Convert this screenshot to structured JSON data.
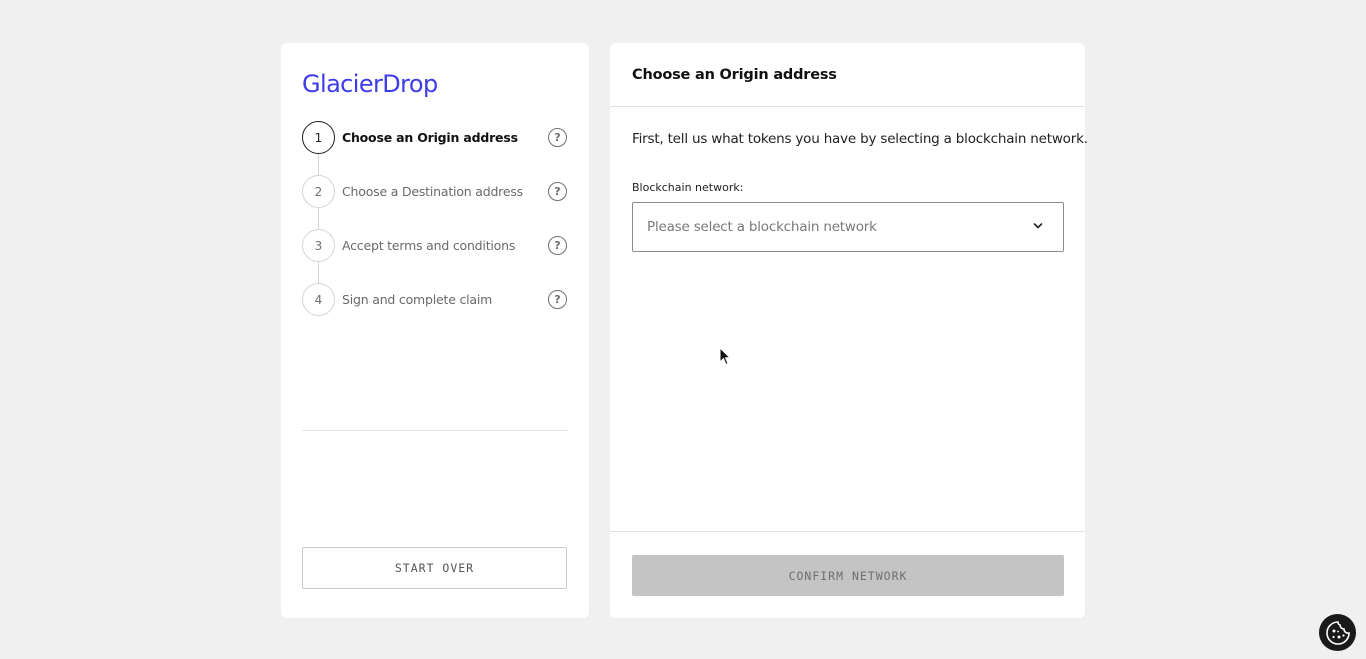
{
  "brand": {
    "logo_text": "GlacierDrop",
    "accent_color": "#3d3ce8"
  },
  "steps": [
    {
      "number": "1",
      "label": "Choose an Origin address",
      "active": true
    },
    {
      "number": "2",
      "label": "Choose a Destination address",
      "active": false
    },
    {
      "number": "3",
      "label": "Accept terms and conditions",
      "active": false
    },
    {
      "number": "4",
      "label": "Sign and complete claim",
      "active": false
    }
  ],
  "help_icon_glyph": "?",
  "left_panel": {
    "start_over_label": "START OVER"
  },
  "main": {
    "title": "Choose an Origin address",
    "intro": "First, tell us what tokens you have by selecting a blockchain network.",
    "field_label": "Blockchain network:",
    "select_placeholder": "Please select a blockchain network",
    "confirm_label": "CONFIRM NETWORK"
  },
  "icons": {
    "help": "question-circle-icon",
    "dropdown": "chevron-down-icon",
    "cookie": "cookie-icon",
    "cursor": "mouse-pointer-icon"
  }
}
